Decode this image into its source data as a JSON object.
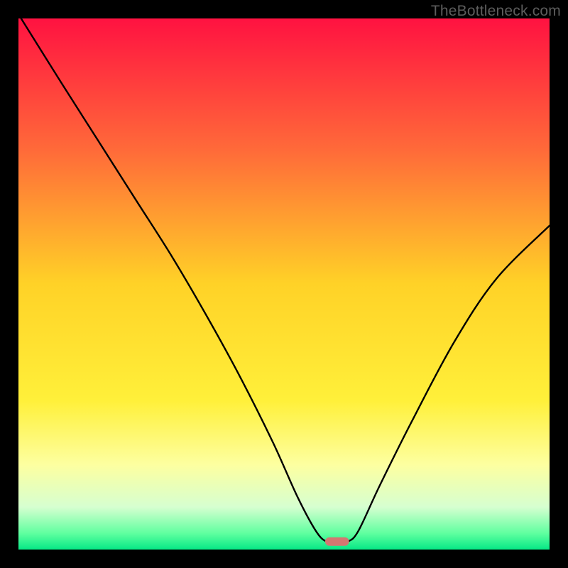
{
  "watermark": "TheBottleneck.com",
  "chart_data": {
    "type": "line",
    "title": "",
    "xlabel": "",
    "ylabel": "",
    "xlim": [
      0,
      100
    ],
    "ylim": [
      0,
      100
    ],
    "background_gradient": {
      "stops": [
        {
          "offset": 0,
          "color": "#ff1241"
        },
        {
          "offset": 25,
          "color": "#ff6b39"
        },
        {
          "offset": 50,
          "color": "#ffd227"
        },
        {
          "offset": 72,
          "color": "#fff03a"
        },
        {
          "offset": 84,
          "color": "#fdffa0"
        },
        {
          "offset": 92,
          "color": "#d6ffd0"
        },
        {
          "offset": 97,
          "color": "#5eff9f"
        },
        {
          "offset": 100,
          "color": "#06e886"
        }
      ]
    },
    "series": [
      {
        "name": "bottleneck-curve",
        "type": "line",
        "color": "#000000",
        "points": [
          {
            "x": 0.5,
            "y": 100
          },
          {
            "x": 8,
            "y": 88
          },
          {
            "x": 15,
            "y": 77
          },
          {
            "x": 22,
            "y": 66
          },
          {
            "x": 29,
            "y": 55
          },
          {
            "x": 36,
            "y": 43
          },
          {
            "x": 42,
            "y": 32
          },
          {
            "x": 48,
            "y": 20
          },
          {
            "x": 52.5,
            "y": 10
          },
          {
            "x": 56,
            "y": 3.5
          },
          {
            "x": 58,
            "y": 1.5
          },
          {
            "x": 60,
            "y": 1.5
          },
          {
            "x": 62,
            "y": 1.5
          },
          {
            "x": 64,
            "y": 3.5
          },
          {
            "x": 68,
            "y": 12
          },
          {
            "x": 74,
            "y": 24
          },
          {
            "x": 82,
            "y": 39
          },
          {
            "x": 90,
            "y": 51
          },
          {
            "x": 100,
            "y": 61
          }
        ]
      }
    ],
    "marker": {
      "name": "bottleneck-marker",
      "x": 60,
      "y": 1.5,
      "width": 4.5,
      "height": 1.6,
      "color": "#d47771"
    }
  }
}
